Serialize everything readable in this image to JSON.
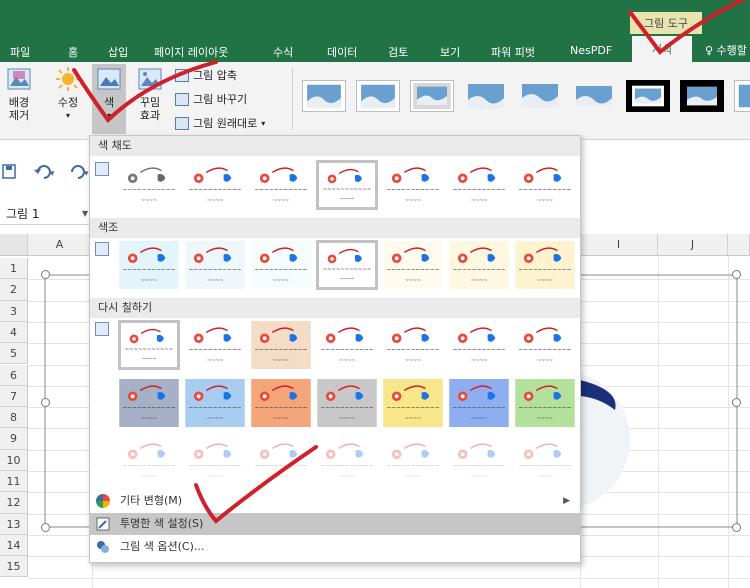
{
  "ribbon_tabs": {
    "contextual_header": "그림 도구",
    "tabs": [
      "파일",
      "홈",
      "삽입",
      "페이지 레이아웃",
      "수식",
      "데이터",
      "검토",
      "보기",
      "파워 피벗",
      "NesPDF",
      "서식"
    ],
    "active_tab": "서식",
    "tell_me": "♀ 수행할"
  },
  "ribbon": {
    "remove_background": "배경\n제거",
    "corrections": "수정",
    "color": "색",
    "artistic_effects": "꾸밈\n효과",
    "compress": "그림 압축",
    "change_picture": "그림 바꾸기",
    "reset_picture": "그림 원래대로",
    "colors": {
      "accent": "#217346",
      "ribbon_bg": "#f3f3f3"
    }
  },
  "namebox": {
    "value": "그림 1",
    "dropdown": "▼"
  },
  "qat": {
    "save": "save-icon",
    "undo": "undo-icon",
    "redo": "redo-icon"
  },
  "sheet": {
    "columns": [
      "A",
      "I",
      "J"
    ],
    "rows": [
      "1",
      "2",
      "3",
      "4",
      "5",
      "6",
      "7",
      "8",
      "9",
      "10",
      "11",
      "12",
      "13",
      "14",
      "15"
    ]
  },
  "dropdown": {
    "sections": [
      {
        "title": "색 채도",
        "icon": "saturation-icon"
      },
      {
        "title": "색조",
        "icon": "tone-icon"
      },
      {
        "title": "다시 칠하기",
        "icon": "recolor-icon"
      }
    ],
    "saturation_selected": 3,
    "tone_selected": 3,
    "recolor_selected": 0,
    "tone_tints": [
      "#e3f4fb",
      "#eef8fb",
      "#f6fbfc",
      "#ffffff",
      "#fffbee",
      "#fff8e0",
      "#fff3cf"
    ],
    "recolor_row1": [
      "#ffffff",
      "#ffffff",
      "#f4dcc6",
      "#ffffff",
      "#ffffff",
      "#ffffff",
      "#ffffff"
    ],
    "recolor_row2": [
      "#a6b1c8",
      "#a9cdf1",
      "#f4a57a",
      "#c8c8c8",
      "#f8e68a",
      "#8eaef0",
      "#b3e09a"
    ],
    "recolor_row3": [
      "#ffffff",
      "#ffffff",
      "#ffffff",
      "#ffffff",
      "#ffffff",
      "#ffffff",
      "#ffffff"
    ],
    "menu": {
      "more_variations": "기타 변형(M)",
      "set_transparent": "투명한 색 설정(S)",
      "picture_color_options": "그림 색 옵션(C)..."
    }
  }
}
